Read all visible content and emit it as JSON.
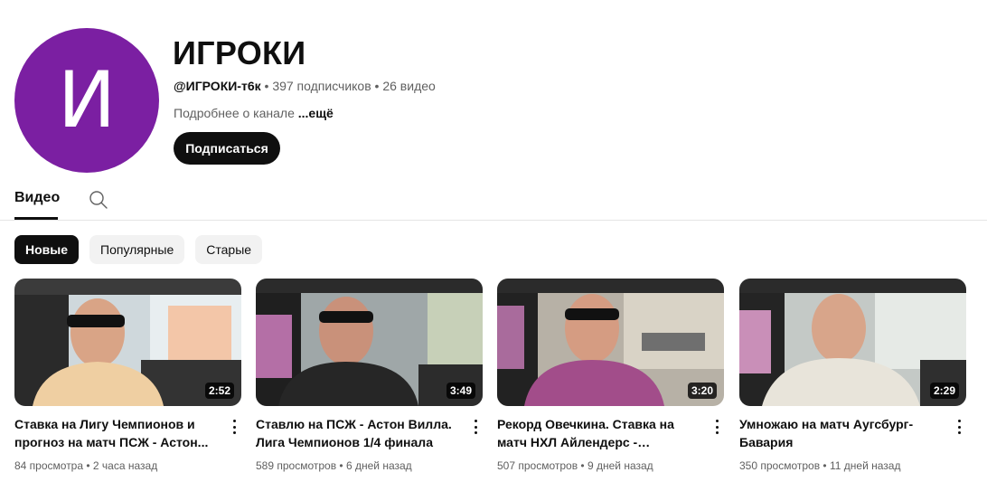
{
  "channel": {
    "avatar_letter": "И",
    "avatar_color": "#7b1fa2",
    "name": "ИГРОКИ",
    "handle": "@ИГРОКИ-т6к",
    "subscribers": "397 подписчиков",
    "video_count": "26 видео",
    "separator": " • ",
    "description": "Подробнее о канале",
    "more_label": "...ещё",
    "subscribe_label": "Подписаться"
  },
  "tabs": {
    "videos_label": "Видео",
    "search_icon": "search-icon"
  },
  "chips": [
    "Новые",
    "Популярные",
    "Старые"
  ],
  "videos": [
    {
      "title": "Ставка на Лигу Чемпионов и прогноз на матч ПСЖ - Астон...",
      "duration": "2:52",
      "views": "84 просмотра",
      "age": "2 часа назад"
    },
    {
      "title": "Ставлю на ПСЖ - Астон Вилла. Лига Чемпионов 1/4 финала",
      "duration": "3:49",
      "views": "589 просмотров",
      "age": "6 дней назад"
    },
    {
      "title": "Рекорд Овечкина. Ставка на матч НХЛ Айлендерс - Вашингтон",
      "duration": "3:20",
      "views": "507 просмотров",
      "age": "9 дней назад"
    },
    {
      "title": "Умножаю на матч Аугсбург-Бавария",
      "duration": "2:29",
      "views": "350 просмотров",
      "age": "11 дней назад"
    }
  ]
}
